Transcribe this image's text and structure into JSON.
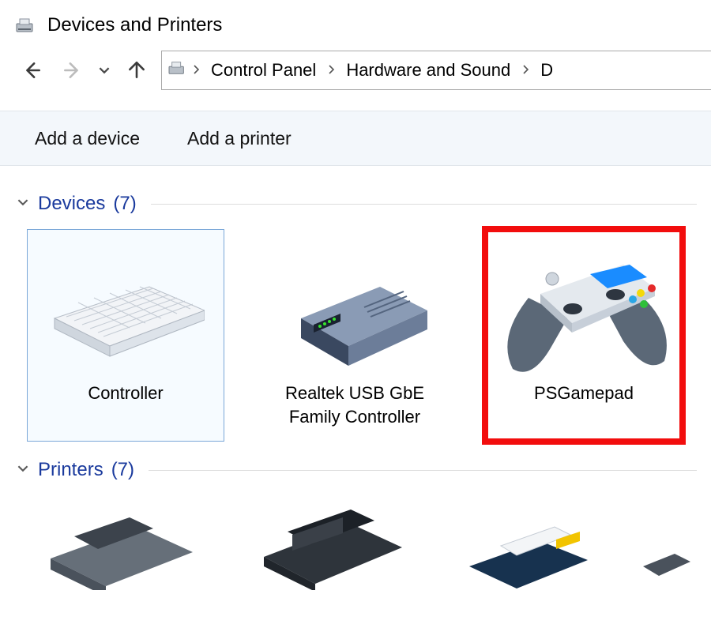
{
  "window": {
    "title": "Devices and Printers"
  },
  "breadcrumb": {
    "items": [
      "Control Panel",
      "Hardware and Sound",
      "D"
    ]
  },
  "toolbar": {
    "add_device": "Add a device",
    "add_printer": "Add a printer"
  },
  "groups": {
    "devices": {
      "title": "Devices",
      "count": "(7)",
      "items": [
        {
          "label": "Controller",
          "icon": "keyboard",
          "selected": true,
          "highlighted": false
        },
        {
          "label": "Realtek USB GbE Family Controller",
          "icon": "network-adapter",
          "selected": false,
          "highlighted": false
        },
        {
          "label": "PSGamepad",
          "icon": "gamepad",
          "selected": false,
          "highlighted": true
        }
      ]
    },
    "printers": {
      "title": "Printers",
      "count": "(7)"
    }
  }
}
